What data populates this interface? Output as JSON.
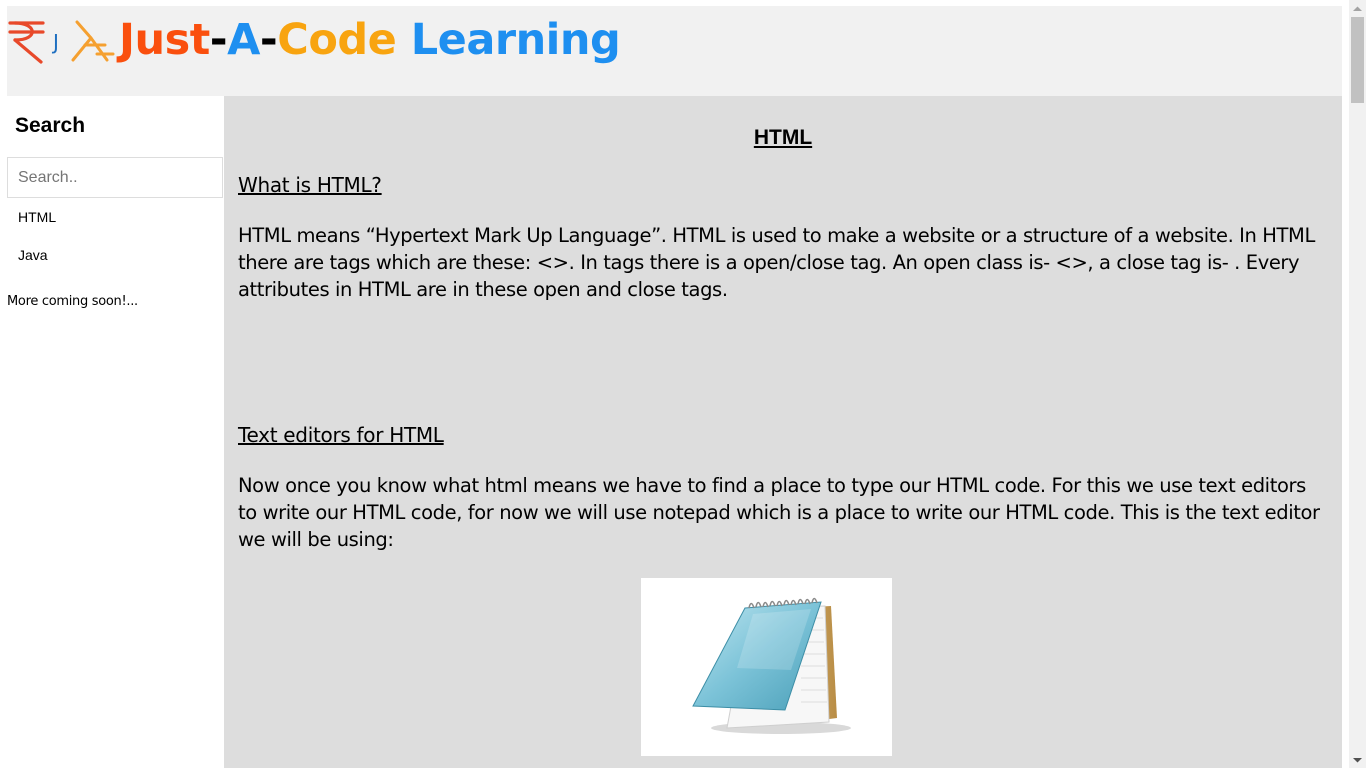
{
  "header": {
    "brand_parts": [
      {
        "text": "Just",
        "color": "#fa4f0e"
      },
      {
        "text": "-",
        "color": "#000000"
      },
      {
        "text": "A",
        "color": "#1e8ff0"
      },
      {
        "text": "-",
        "color": "#000000"
      },
      {
        "text": "Code",
        "color": "#f8a410"
      },
      {
        "text": " Learning",
        "color": "#1e8ff0"
      }
    ],
    "logo_colors": [
      "#e8492a",
      "#1e6fc0",
      "#f5a030"
    ]
  },
  "sidebar": {
    "title": "Search",
    "search_placeholder": "Search..",
    "links": [
      {
        "label": "HTML"
      },
      {
        "label": "Java"
      }
    ],
    "note": "More coming soon!..."
  },
  "main": {
    "title": "HTML",
    "sections": [
      {
        "heading": "What is HTML?",
        "paragraph": "HTML means “Hypertext Mark Up Language”. HTML is used to make a website or a structure of a website. In HTML there are tags which are these: <>. In tags there is a open/close tag. An open class is- <>, a close tag is- . Every attributes in HTML are in these open and close tags."
      },
      {
        "heading": "Text editors for HTML",
        "paragraph": "Now once you know what html means we have to find a place to type our HTML code. For this we use text editors to write our HTML code, for now we will use notepad which is a place to write our HTML code. This is the text editor we will be using:"
      }
    ],
    "image_icon": "notepad-icon"
  },
  "colors": {
    "header_bg": "#f1f1f1",
    "main_bg": "#dddddd",
    "sidebar_bg": "#ffffff"
  }
}
